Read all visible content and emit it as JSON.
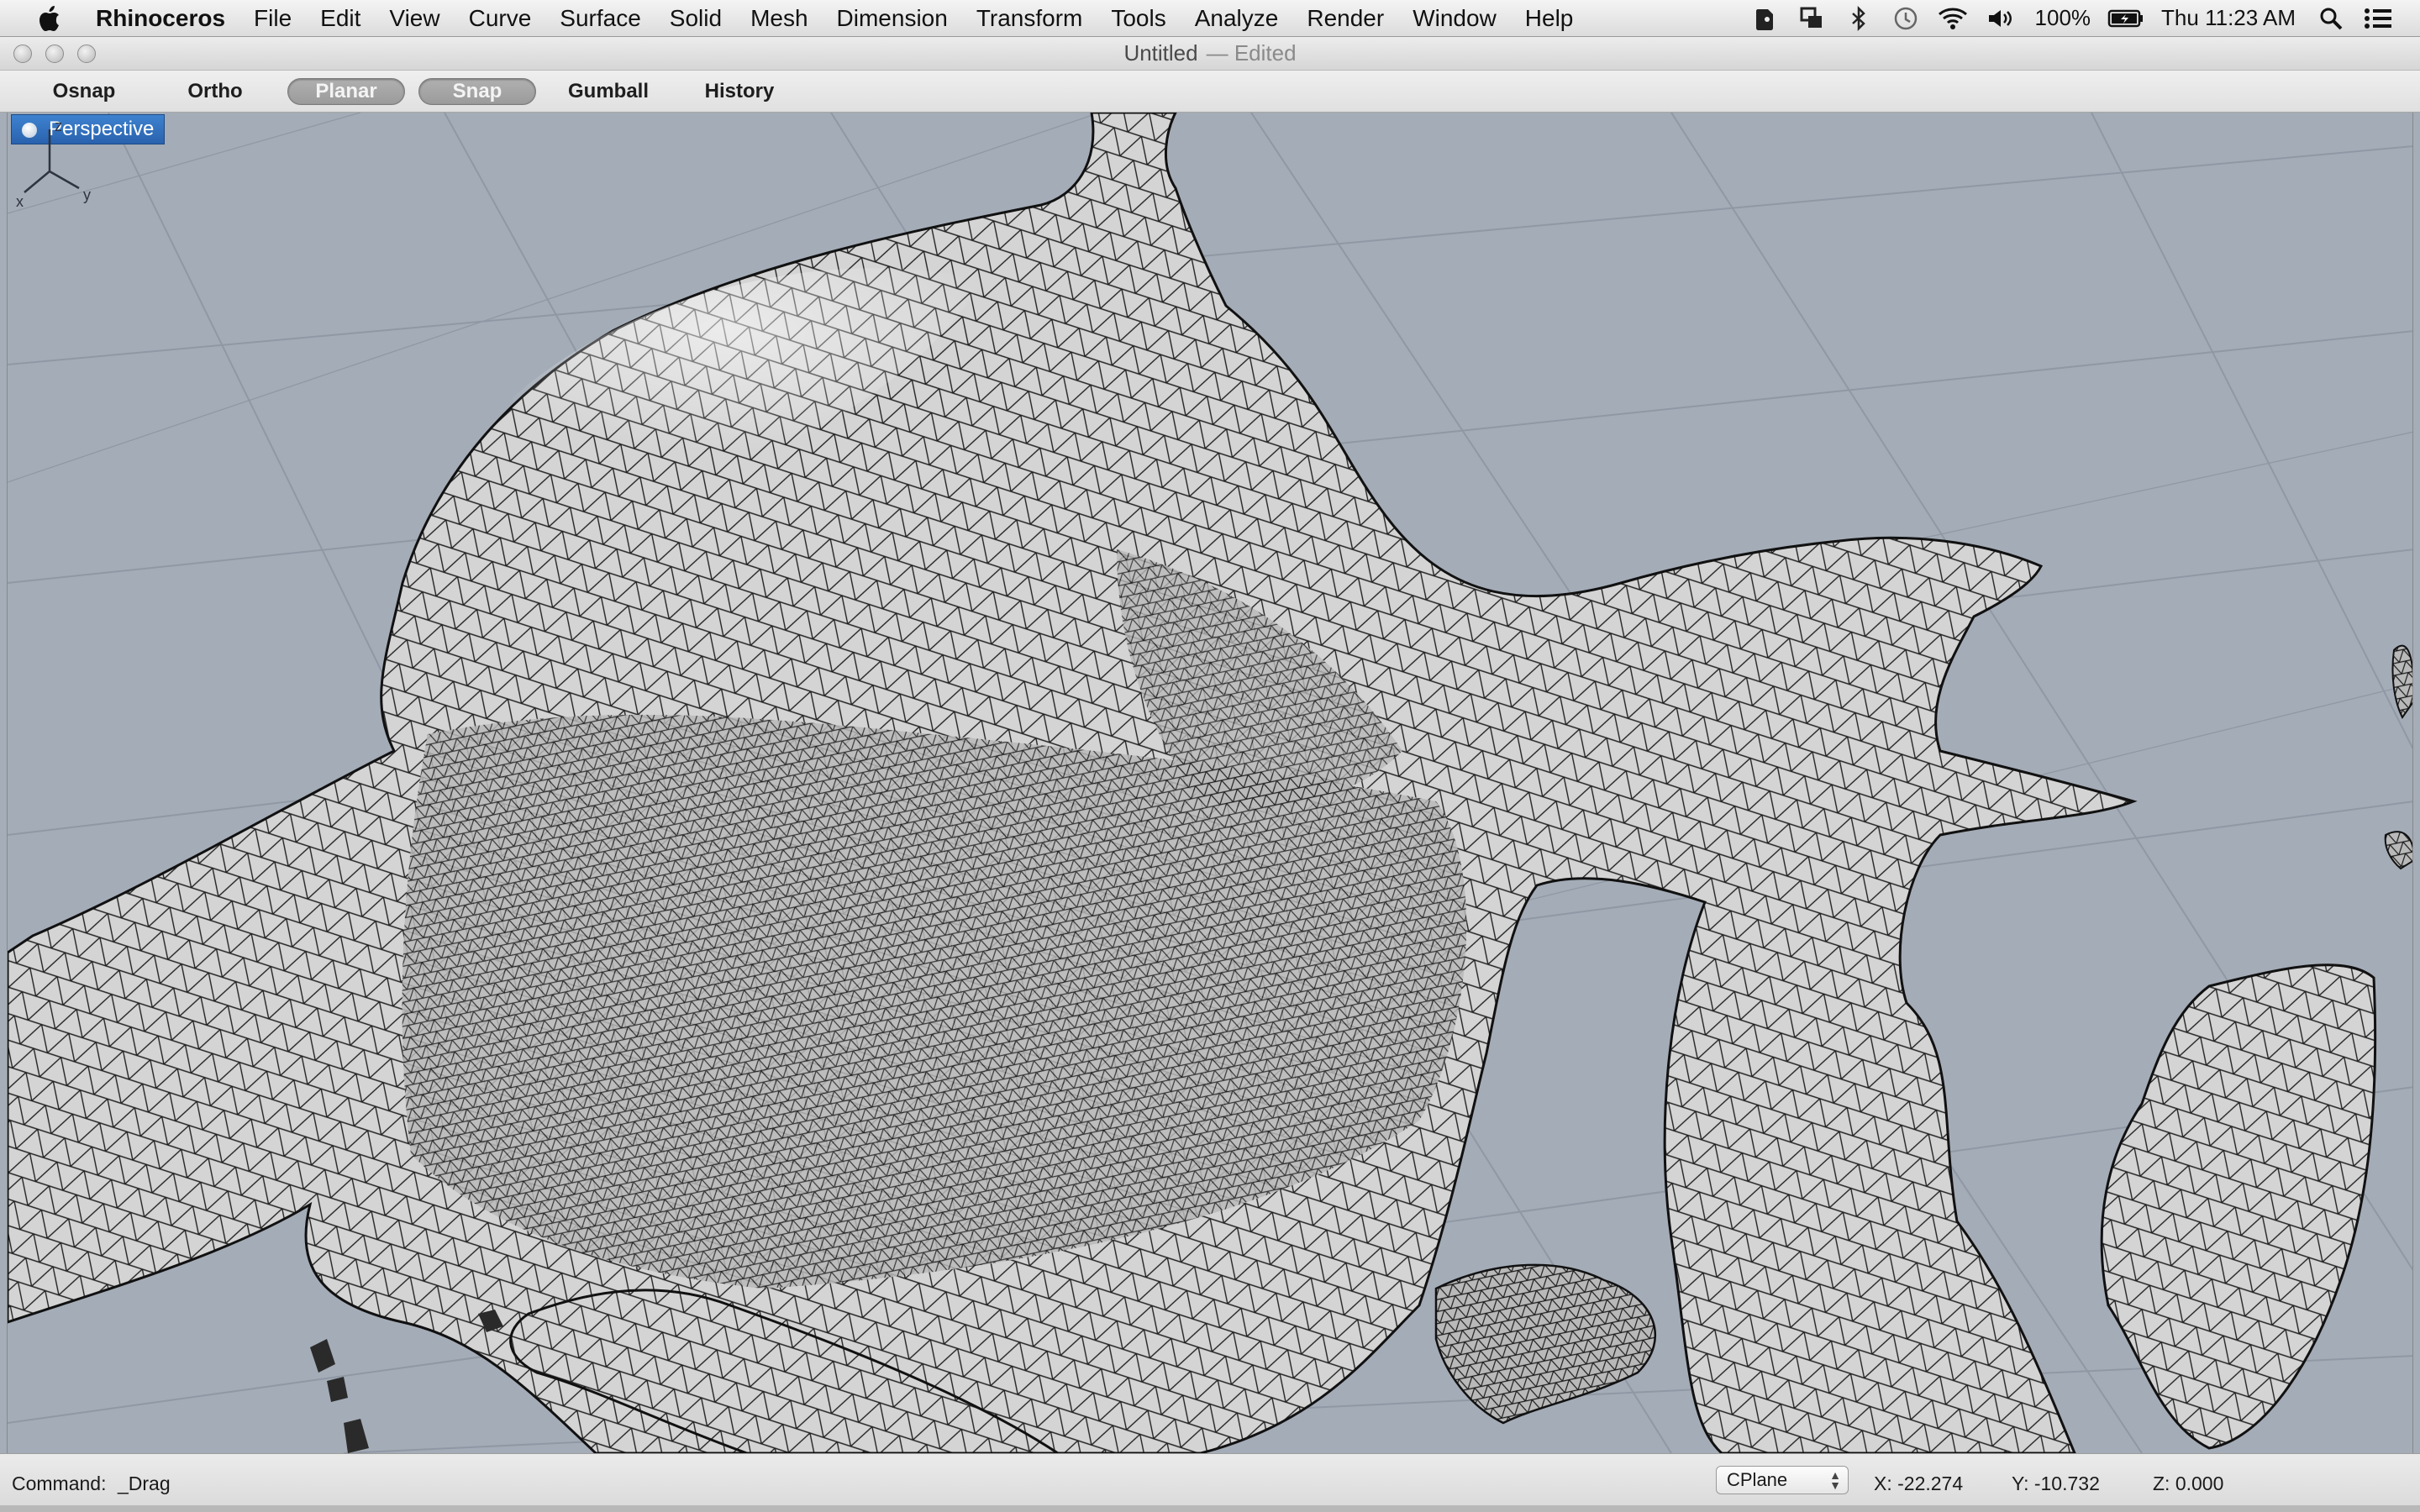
{
  "menubar": {
    "app_name": "Rhinoceros",
    "items": [
      "File",
      "Edit",
      "View",
      "Curve",
      "Surface",
      "Solid",
      "Mesh",
      "Dimension",
      "Transform",
      "Tools",
      "Analyze",
      "Render",
      "Window",
      "Help"
    ],
    "battery": "100%",
    "clock": "Thu 11:23 AM"
  },
  "window": {
    "title": "Untitled",
    "edited": "— Edited"
  },
  "modes": {
    "osnap": "Osnap",
    "ortho": "Ortho",
    "planar": "Planar",
    "snap": "Snap",
    "gumball": "Gumball",
    "history": "History"
  },
  "viewport": {
    "name": "Perspective",
    "axis_x": "x",
    "axis_y": "y",
    "axis_z": "z"
  },
  "statusbar": {
    "command_label": "Command:",
    "command_value": "_Drag",
    "cplane": "CPlane",
    "x": "X: -22.274",
    "y": "Y: -10.732",
    "z": "Z: 0.000"
  },
  "colors": {
    "viewport_bg": "#a4acb7",
    "grid_line": "#8f98a4",
    "mesh_fill": "#d9d9d9",
    "mesh_wire": "#1a1a1a",
    "viewport_label": "#2f6cb8"
  }
}
